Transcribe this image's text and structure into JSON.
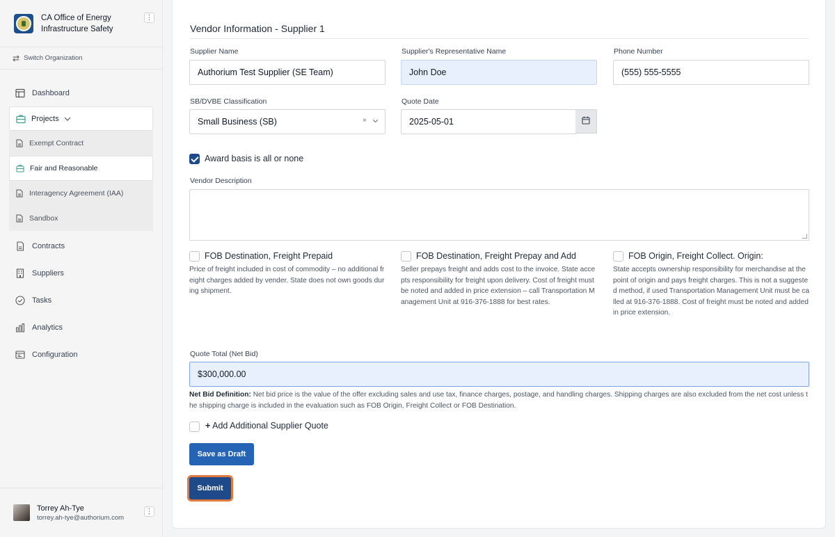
{
  "org": {
    "name": "CA Office of Energy Infrastructure Safety",
    "menu_icon": "kebab-icon"
  },
  "switch_org": {
    "label": "Switch Organization",
    "icon": "switch-icon"
  },
  "nav": {
    "dashboard": "Dashboard",
    "projects": "Projects",
    "projects_sub": [
      "Exempt Contract",
      "Fair and Reasonable",
      "Interagency Agreement (IAA)",
      "Sandbox"
    ],
    "contracts": "Contracts",
    "suppliers": "Suppliers",
    "tasks": "Tasks",
    "analytics": "Analytics",
    "configuration": "Configuration"
  },
  "user": {
    "name": "Torrey Ah-Tye",
    "email": "torrey.ah-tye@authorium.com"
  },
  "form": {
    "title": "Vendor Information - Supplier 1",
    "supplier_name": {
      "label": "Supplier Name",
      "value": "Authorium Test Supplier (SE Team)"
    },
    "rep_name": {
      "label": "Supplier's Representative Name",
      "value": "John Doe"
    },
    "phone": {
      "label": "Phone Number",
      "value": "(555) 555-5555"
    },
    "classification": {
      "label": "SB/DVBE Classification",
      "value": "Small Business (SB)",
      "clear": "×",
      "chevron": "⌄"
    },
    "quote_date": {
      "label": "Quote Date",
      "value": "2025-05-01"
    },
    "award_basis": {
      "label": "Award basis is all or none",
      "checked": true
    },
    "vendor_description": {
      "label": "Vendor Description",
      "value": ""
    },
    "fob": [
      {
        "label": "FOB Destination, Freight Prepaid",
        "desc": "Price of freight included in cost of commodity – no additional freight charges added by vender. State does not own goods during shipment."
      },
      {
        "label": "FOB Destination, Freight Prepay and Add",
        "desc": "Seller prepays freight and adds cost to the invoice. State accepts responsibility for freight upon delivery. Cost of freight must be noted and added in price extension – call Transportation Management Unit at 916-376-1888 for best rates."
      },
      {
        "label": "FOB Origin, Freight Collect. Origin:",
        "desc": "State accepts ownership responsibility for merchandise at the point of origin and pays freight charges. This is not a suggested method, if used Transportation Management Unit must be called at 916-376-1888. Cost of freight must be noted and added in price extension."
      }
    ],
    "quote_total": {
      "label": "Quote Total (Net Bid)",
      "value": "$300,000.00"
    },
    "net_bid": {
      "term": "Net Bid Definition:",
      "text": "Net bid price is the value of the offer excluding sales and use tax, finance charges, postage, and handling charges. Shipping charges are also excluded from the net cost unless the shipping charge is included in the evaluation such as FOB Origin, Freight Collect or FOB Destination."
    },
    "add_quote": {
      "plus": "+",
      "label": "Add Additional Supplier Quote"
    },
    "save_draft": "Save as Draft",
    "submit": "Submit"
  }
}
